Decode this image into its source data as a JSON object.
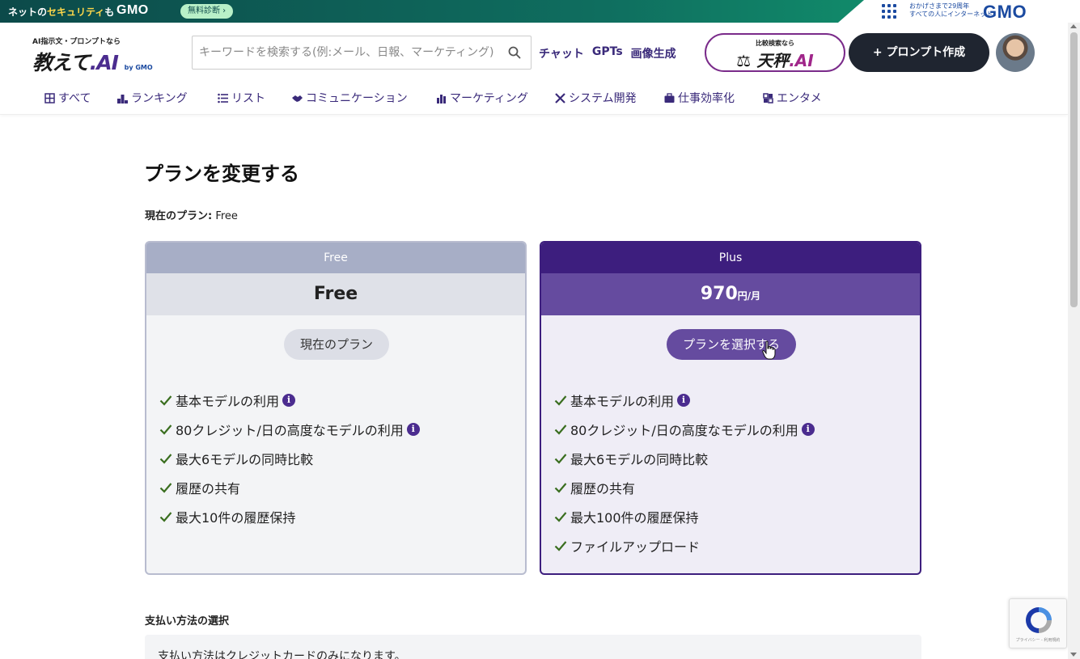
{
  "banner": {
    "tag_prefix": "ネットの",
    "tag_highlight": "セキュリティ",
    "tag_suffix": "も",
    "gmo": "GMO",
    "cta": "無料診断 ›",
    "right_line1": "おかげさまで29周年",
    "right_line2": "すべての人にインターネット",
    "right_logo": "GMO"
  },
  "header": {
    "logo_sub": "AI指示文・プロンプトなら",
    "logo_text": "教えて",
    "logo_ai": ".AI",
    "logo_by": "by GMO",
    "search_placeholder": "キーワードを検索する(例:メール、日報、マーケティング)",
    "links": [
      "チャット",
      "GPTs",
      "画像生成"
    ],
    "tenbin_sub": "比較検索なら",
    "tenbin_text": "天秤",
    "tenbin_ai": ".AI",
    "create_button": "+ プロンプト作成"
  },
  "nav": {
    "items": [
      {
        "label": "すべて",
        "icon": "grid-icon"
      },
      {
        "label": "ランキング",
        "icon": "ranking-icon"
      },
      {
        "label": "リスト",
        "icon": "list-icon"
      },
      {
        "label": "コミュニケーション",
        "icon": "handshake-icon"
      },
      {
        "label": "マーケティング",
        "icon": "bar-chart-icon"
      },
      {
        "label": "システム開発",
        "icon": "tools-icon"
      },
      {
        "label": "仕事効率化",
        "icon": "briefcase-icon"
      },
      {
        "label": "エンタメ",
        "icon": "puzzle-icon"
      }
    ]
  },
  "main": {
    "title": "プランを変更する",
    "current_plan_label": "現在のプラン:",
    "current_plan_value": "Free",
    "plans": [
      {
        "name": "Free",
        "price": "Free",
        "price_unit": "",
        "button": "現在のプラン",
        "features": [
          {
            "text": "基本モデルの利用",
            "info": true
          },
          {
            "text": "80クレジット/日の高度なモデルの利用",
            "info": true
          },
          {
            "text": "最大6モデルの同時比較",
            "info": false
          },
          {
            "text": "履歴の共有",
            "info": false
          },
          {
            "text": "最大10件の履歴保持",
            "info": false
          }
        ]
      },
      {
        "name": "Plus",
        "price": "970",
        "price_unit": "円/月",
        "button": "プランを選択する",
        "features": [
          {
            "text": "基本モデルの利用",
            "info": true
          },
          {
            "text": "80クレジット/日の高度なモデルの利用",
            "info": true
          },
          {
            "text": "最大6モデルの同時比較",
            "info": false
          },
          {
            "text": "履歴の共有",
            "info": false
          },
          {
            "text": "最大100件の履歴保持",
            "info": false
          },
          {
            "text": "ファイルアップロード",
            "info": false
          }
        ]
      }
    ],
    "info_glyph": "i",
    "payment_title": "支払い方法の選択",
    "payment_text": "支払い方法はクレジットカードのみになります。"
  },
  "recaptcha": {
    "text": "プライバシー - 利用規約"
  },
  "colors": {
    "accent": "#4b2c8f",
    "plus_header": "#3d1e7e",
    "plus_price": "#654b9f",
    "free_header": "#a7aec6",
    "check": "#3a6e1f"
  }
}
